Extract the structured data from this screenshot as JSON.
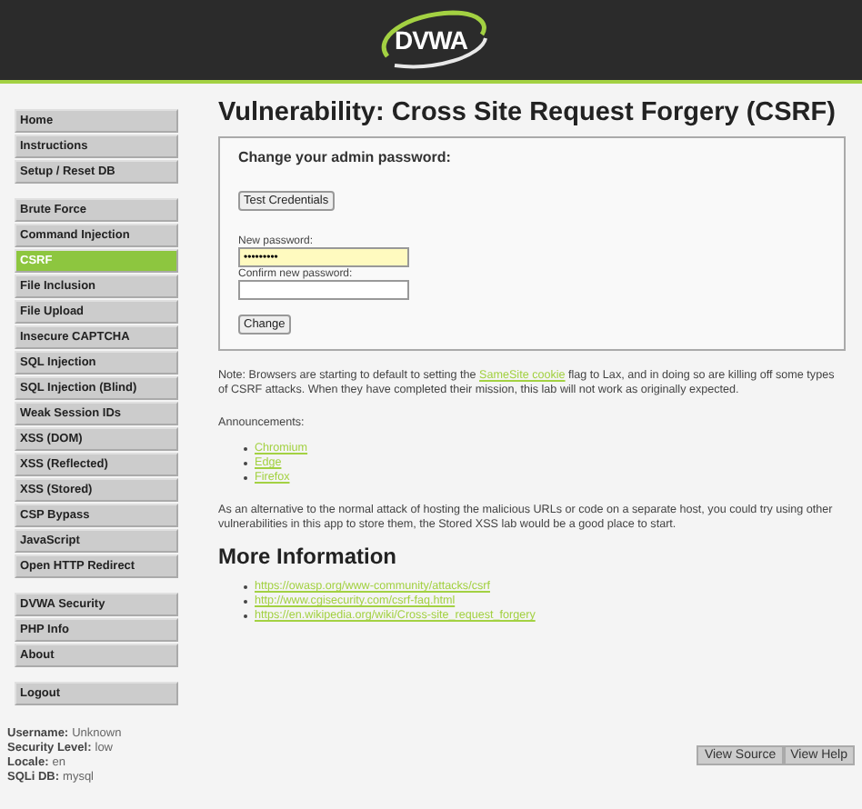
{
  "header": {
    "logo": "DVWA"
  },
  "sidebar": {
    "groups": [
      {
        "items": [
          {
            "label": "Home",
            "selected": false
          },
          {
            "label": "Instructions",
            "selected": false
          },
          {
            "label": "Setup / Reset DB",
            "selected": false
          }
        ]
      },
      {
        "items": [
          {
            "label": "Brute Force",
            "selected": false
          },
          {
            "label": "Command Injection",
            "selected": false
          },
          {
            "label": "CSRF",
            "selected": true
          },
          {
            "label": "File Inclusion",
            "selected": false
          },
          {
            "label": "File Upload",
            "selected": false
          },
          {
            "label": "Insecure CAPTCHA",
            "selected": false
          },
          {
            "label": "SQL Injection",
            "selected": false
          },
          {
            "label": "SQL Injection (Blind)",
            "selected": false
          },
          {
            "label": "Weak Session IDs",
            "selected": false
          },
          {
            "label": "XSS (DOM)",
            "selected": false
          },
          {
            "label": "XSS (Reflected)",
            "selected": false
          },
          {
            "label": "XSS (Stored)",
            "selected": false
          },
          {
            "label": "CSP Bypass",
            "selected": false
          },
          {
            "label": "JavaScript",
            "selected": false
          },
          {
            "label": "Open HTTP Redirect",
            "selected": false
          }
        ]
      },
      {
        "items": [
          {
            "label": "DVWA Security",
            "selected": false
          },
          {
            "label": "PHP Info",
            "selected": false
          },
          {
            "label": "About",
            "selected": false
          }
        ]
      },
      {
        "items": [
          {
            "label": "Logout",
            "selected": false
          }
        ]
      }
    ]
  },
  "status": [
    {
      "label": "Username:",
      "value": "Unknown"
    },
    {
      "label": "Security Level:",
      "value": "low"
    },
    {
      "label": "Locale:",
      "value": "en"
    },
    {
      "label": "SQLi DB:",
      "value": "mysql"
    }
  ],
  "content": {
    "title": "Vulnerability: Cross Site Request Forgery (CSRF)",
    "form": {
      "heading": "Change your admin password:",
      "test_button": "Test Credentials",
      "new_label": "New password:",
      "new_value": "•••••••••",
      "confirm_label": "Confirm new password:",
      "submit": "Change"
    },
    "note": {
      "before": "Note: Browsers are starting to default to setting the",
      "link": "SameSite cookie",
      "after": "flag to Lax, and in doing so are killing off some types of CSRF attacks. When they have completed their mission, this lab will not work as originally expected."
    },
    "announcements_label": "Announcements:",
    "announcements": [
      "Chromium",
      "Edge",
      "Firefox"
    ],
    "alternative": "As an alternative to the normal attack of hosting the malicious URLs or code on a separate host, you could try using other vulnerabilities in this app to store them, the Stored XSS lab would be a good place to start.",
    "more_heading": "More Information",
    "links": [
      "https://owasp.org/www-community/attacks/csrf",
      "http://www.cgisecurity.com/csrf-faq.html",
      "https://en.wikipedia.org/wiki/Cross-site_request_forgery"
    ]
  },
  "footer_buttons": [
    "View Source",
    "View Help"
  ]
}
